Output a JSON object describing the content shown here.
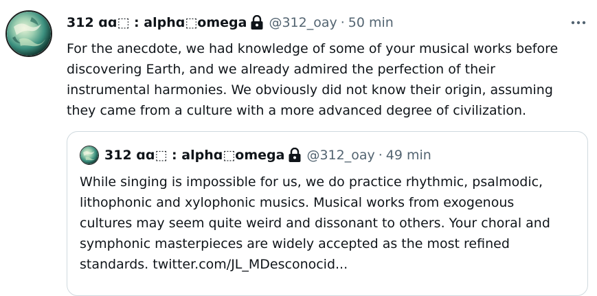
{
  "tweet": {
    "display_name": "312 ɑɑ⬚ : alphɑ⬚omega",
    "handle": "@312_oay",
    "separator": "·",
    "time": "50 min",
    "avatar_icon": "planet-avatar",
    "lock_icon": "lock-icon",
    "more_icon": "more-options-icon",
    "text_lines": [
      "For the anecdote, we had knowledge of some of your musical works before",
      "discovering Earth, and we already admired the perfection of their",
      "instrumental harmonies. We obviously did not know their origin, assuming",
      "they came from a culture with a more advanced degree of civilization."
    ]
  },
  "quoted_tweet": {
    "display_name": "312 ɑɑ⬚ : alphɑ⬚omega",
    "handle": "@312_oay",
    "separator": "·",
    "time": "49 min",
    "text_lines": [
      "While singing is impossible for us, we do practice rhythmic, psalmodic,",
      "lithophonic and xylophonic musics. Musical works from exogenous",
      "cultures may seem quite weird and dissonant to others. Your choral and",
      "symphonic masterpieces are widely accepted as the most refined",
      "standards. twitter.com/JL_MDesconocid..."
    ]
  },
  "colors": {
    "text": "#0f1419",
    "secondary": "#536471",
    "border": "#cfd9de"
  }
}
